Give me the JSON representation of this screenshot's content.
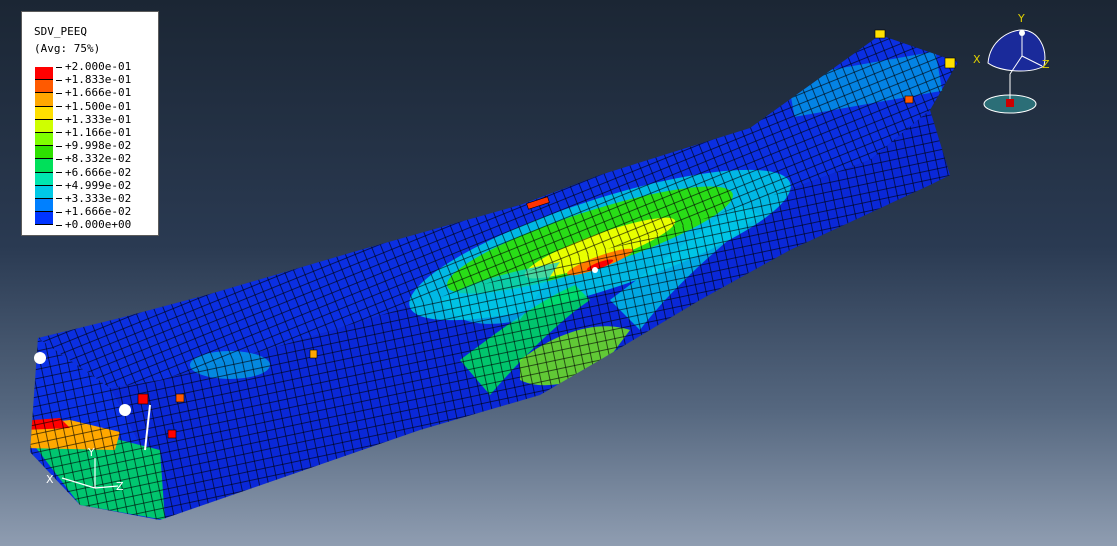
{
  "legend": {
    "title": "SDV_PEEQ",
    "subtitle": "(Avg: 75%)",
    "values": [
      "+2.000e-01",
      "+1.833e-01",
      "+1.666e-01",
      "+1.500e-01",
      "+1.333e-01",
      "+1.166e-01",
      "+9.998e-02",
      "+8.332e-02",
      "+6.666e-02",
      "+4.999e-02",
      "+3.333e-02",
      "+1.666e-02",
      "+0.000e+00"
    ],
    "colors": [
      "#ff0000",
      "#ff5a00",
      "#ffa800",
      "#ffe000",
      "#cfff00",
      "#7fff00",
      "#2ee100",
      "#00e05a",
      "#00e6b0",
      "#00c8e6",
      "#0080ff",
      "#0034ff",
      "#0000d8"
    ]
  },
  "triad_global": {
    "y": "Y",
    "x": "X",
    "z": "Z"
  },
  "triad_local": {
    "y": "Y",
    "x": "X",
    "z": "Z"
  },
  "colors": {
    "mesh_base": "#0a2ee0",
    "edge": "#000000",
    "background_top": "#1b2634",
    "background_bottom": "#8f9db1"
  }
}
